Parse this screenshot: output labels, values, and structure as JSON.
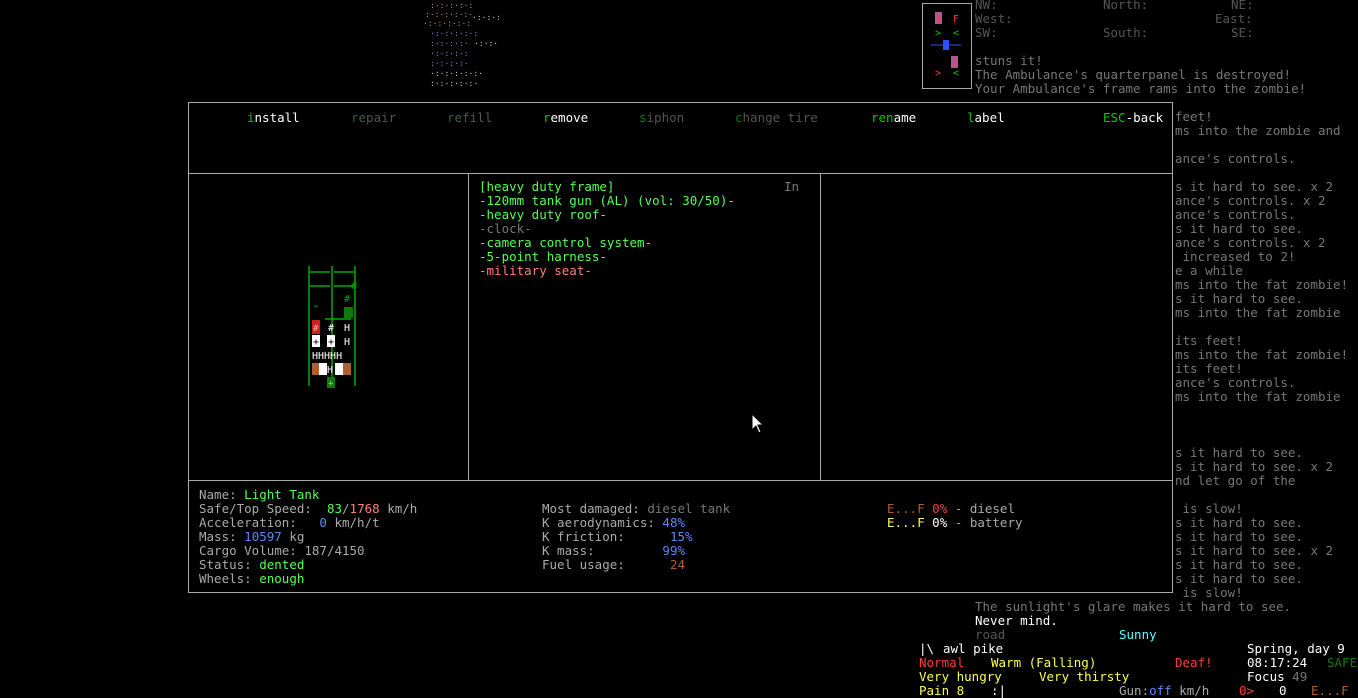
{
  "compass": {
    "nw": "NW:",
    "north": "North:",
    "ne": "NE:",
    "west": "West:",
    "east": "East:",
    "sw": "SW:",
    "south": "South:",
    "se": "SE:"
  },
  "top_log": [
    "stuns it!",
    "The Ambulance's quarterpanel is destroyed!",
    "Your Ambulance's frame rams into the zombie!"
  ],
  "menu": {
    "install": "install",
    "repair": "repair",
    "refill": "refill",
    "remove": "remove",
    "siphon": "siphon",
    "change_tire": "change tire",
    "rename": "rename",
    "label": "label",
    "esc_back": "ESC-back"
  },
  "parts_panel": {
    "header": "[heavy duty frame]",
    "in_label": "In",
    "parts": [
      {
        "text": "-120mm tank gun (AL) (vol: 30/50)-",
        "color": "#55ff55"
      },
      {
        "text": "-heavy duty roof-",
        "color": "#55ff55"
      },
      {
        "text": "-clock-",
        "color": "#777777"
      },
      {
        "text": "-camera control system-",
        "color": "#55ff55"
      },
      {
        "text": "-5-point harness-",
        "color": "#55ff55"
      },
      {
        "text": "-military seat-",
        "color": "#ff7f7f"
      }
    ]
  },
  "vehicle_info": {
    "name_label": "Name:",
    "name": "Light Tank",
    "speed_label": "Safe/Top Speed:",
    "safe_speed": "83",
    "top_speed": "1768",
    "speed_unit": "km/h",
    "accel_label": "Acceleration:",
    "accel": "0",
    "accel_unit": "km/h/t",
    "mass_label": "Mass:",
    "mass": "10597",
    "mass_unit": "kg",
    "cargo_label": "Cargo Volume:",
    "cargo": "187/4150",
    "status_label": "Status:",
    "status": "dented",
    "wheels_label": "Wheels:",
    "wheels": "enough",
    "most_damaged_label": "Most damaged:",
    "most_damaged": "diesel tank",
    "k_aero_label": "K aerodynamics:",
    "k_aero": "48%",
    "k_friction_label": "K friction:",
    "k_friction": "15%",
    "k_mass_label": "K mass:",
    "k_mass": "99%",
    "fuel_usage_label": "Fuel usage:",
    "fuel_usage": "24",
    "fuel": [
      {
        "gauge": "E...F",
        "pct": "0%",
        "name": "- diesel",
        "gauge_color": "#b0602a"
      },
      {
        "gauge": "E...F",
        "pct": "0%",
        "name": "- battery",
        "gauge_color": "#ffff55"
      }
    ]
  },
  "side_log": [
    "feet!",
    "ms into the zombie and",
    "",
    "ance's controls.",
    "",
    "s it hard to see. x 2",
    "ance's controls. x 2",
    "ance's controls.",
    "s it hard to see.",
    "ance's controls. x 2",
    " increased to 2!",
    "e a while",
    "ms into the fat zombie!",
    "s it hard to see.",
    "ms into the fat zombie",
    "",
    "its feet!",
    "ms into the fat zombie!",
    "its feet!",
    "ance's controls.",
    "ms into the fat zombie",
    "",
    "",
    "",
    "s it hard to see.",
    "s it hard to see. x 2",
    "nd let go of the",
    "",
    " is slow!",
    "s it hard to see.",
    "s it hard to see.",
    "s it hard to see. x 2",
    "s it hard to see.",
    "s it hard to see.",
    " is slow!"
  ],
  "bottom_log": {
    "glare": "The sunlight's glare makes it hard to see.",
    "never_mind": "Never mind."
  },
  "status_bar": {
    "terrain": "road",
    "weather": "Sunny",
    "wield_glyph": "|\\",
    "wield": "awl pike",
    "season": "Spring, day 9",
    "normal": "Normal",
    "temp": "Warm (Falling)",
    "deaf": "Deaf!",
    "time": "08:17:24",
    "safe": "SAFE",
    "hunger": "Very hungry",
    "thirst": "Very thirsty",
    "focus_label": "Focus",
    "focus": "49",
    "pain": "Pain 8",
    "mood": ":|",
    "gun_label": "Gun:",
    "gun": "off",
    "speed_unit": "km/h",
    "arrow": "0>",
    "zero": "0",
    "ef": "E...F"
  }
}
